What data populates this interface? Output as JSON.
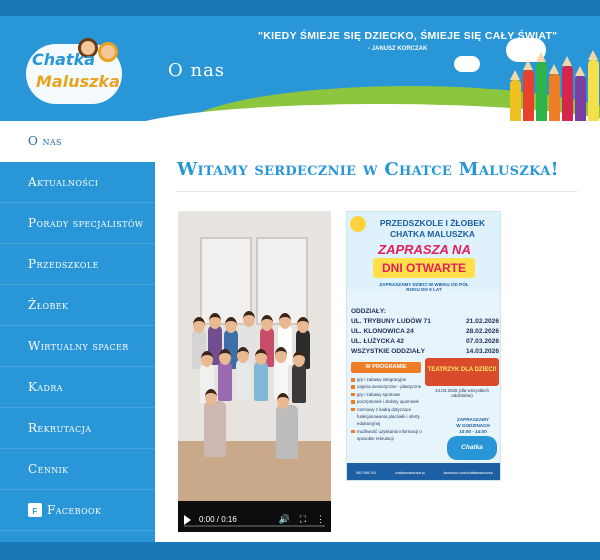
{
  "header": {
    "logo_line1": "Chatka",
    "logo_line2": "Maluszka",
    "page_heading": "O nas",
    "quote": "\"KIEDY ŚMIEJE SIĘ DZIECKO, ŚMIEJE SIĘ CAŁY ŚWIAT\"",
    "quote_author": "- JANUSZ KORCZAK"
  },
  "sidebar": {
    "items": [
      {
        "label": "O nas"
      },
      {
        "label": "Aktualności"
      },
      {
        "label": "Porady specjalistów"
      },
      {
        "label": "Przedszkole"
      },
      {
        "label": "Żłobek"
      },
      {
        "label": "Wirtualny spacer"
      },
      {
        "label": "Kadra"
      },
      {
        "label": "Rekrutacja"
      },
      {
        "label": "Cennik"
      },
      {
        "label": "Facebook"
      }
    ]
  },
  "main": {
    "title": "Witamy serdecznie w Chatce Maluszka!",
    "video": {
      "time": "0:00 / 0:16",
      "progress": 0
    },
    "poster": {
      "line1": "PRZEDSZKOLE I ŻŁOBEK",
      "line2": "CHATKA MALUSZKA",
      "line3": "ZAPRASZA NA",
      "line4": "DNI OTWARTE",
      "subtitle": "ZAPRASZAMY DZIECI W WIEKU OD PÓŁ ROKU DO 6 LAT",
      "odd_label": "ODDZIAŁY:",
      "rows": [
        {
          "place": "UL. TRYBUNY LUDÓW 71",
          "date": "21.02.2026"
        },
        {
          "place": "UL. KLONOWICA 24",
          "date": "28.02.2026"
        },
        {
          "place": "UL. ŁUŻYCKA 42",
          "date": "07.03.2026"
        },
        {
          "place": "WSZYSTKIE ODDZIAŁY",
          "date": "14.03.2026"
        }
      ],
      "program_label": "W PROGRAMIE",
      "program": [
        "gry i zabawy integracyjne",
        "zajęcia sensoryczne - plastyczne",
        "gry i zabawy sportowe",
        "poczęstunek i drobny upominek",
        "rozmowy z kadrą dotyczące funkcjonowania placówki i oferty edukacyjnej",
        "możliwość uzyskania informacji o sposobie rekrutacji"
      ],
      "teatr": "TEATRZYK DLA DZIECI!",
      "teatr_sub": "14.03.2026 (dla wszystkich oddziałów)",
      "hours_line1": "ZAPRASZAMY",
      "hours_line2": "W GODZINACH",
      "hours_line3": "10:00 - 14:00",
      "logo": "Chatka Maluszka",
      "footer1": "662 998 191",
      "footer2": "chatkamaluszka.pl",
      "footer3": "facebook.com/chatkamaluszka"
    }
  }
}
